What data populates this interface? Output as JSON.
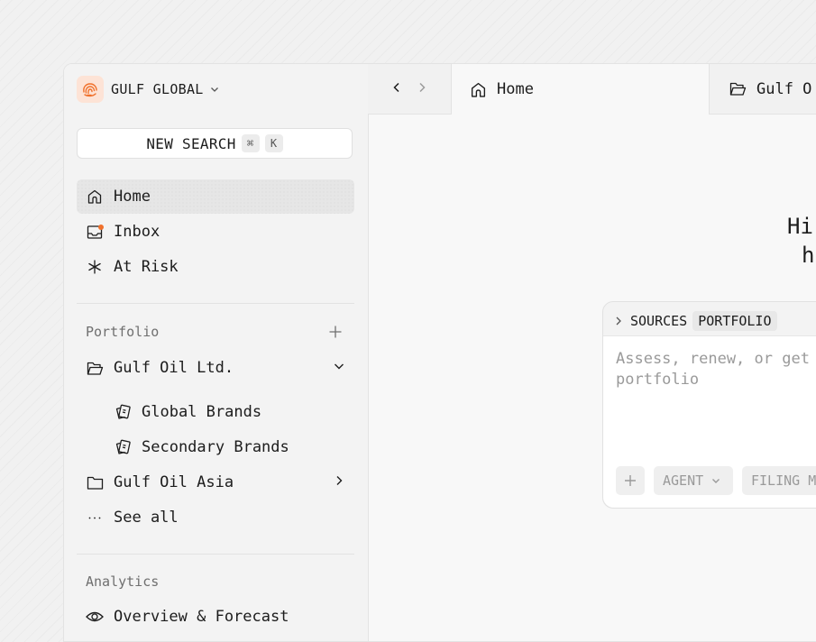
{
  "org": {
    "name": "GULF GLOBAL",
    "accent": "#f0712c",
    "logo_bg": "#fde3d6"
  },
  "search": {
    "label": "NEW SEARCH",
    "shortcut_mod": "⌘",
    "shortcut_key": "K"
  },
  "nav": {
    "items": [
      {
        "label": "Home",
        "icon": "home-icon",
        "active": true
      },
      {
        "label": "Inbox",
        "icon": "inbox-icon",
        "badge": "unread-dot"
      },
      {
        "label": "At Risk",
        "icon": "asterisk-icon"
      }
    ]
  },
  "portfolio": {
    "title": "Portfolio",
    "items": [
      {
        "label": "Gulf Oil Ltd.",
        "icon": "folder-open-icon",
        "expanded": true
      },
      {
        "label": "Global Brands",
        "icon": "brand-cards-icon"
      },
      {
        "label": "Secondary Brands",
        "icon": "brand-cards-icon"
      },
      {
        "label": "Gulf Oil Asia",
        "icon": "folder-icon",
        "expanded": false
      },
      {
        "label": "See all",
        "icon": "ellipsis-icon"
      }
    ]
  },
  "analytics": {
    "title": "Analytics",
    "items": [
      {
        "label": "Overview & Forecast",
        "icon": "eye-icon"
      }
    ]
  },
  "tabs": [
    {
      "label": "Home",
      "icon": "home-icon",
      "active": true
    },
    {
      "label": "Gulf O",
      "icon": "folder-open-icon",
      "active": false
    }
  ],
  "main": {
    "greeting_line1": "Hi",
    "greeting_line2": "h",
    "composer": {
      "sources_label": "SOURCES",
      "source_pill": "PORTFOLIO",
      "placeholder_line1": "Assess, renew, or get",
      "placeholder_line2": "portfolio",
      "agent_label": "AGENT",
      "filing_label": "FILING M"
    }
  }
}
